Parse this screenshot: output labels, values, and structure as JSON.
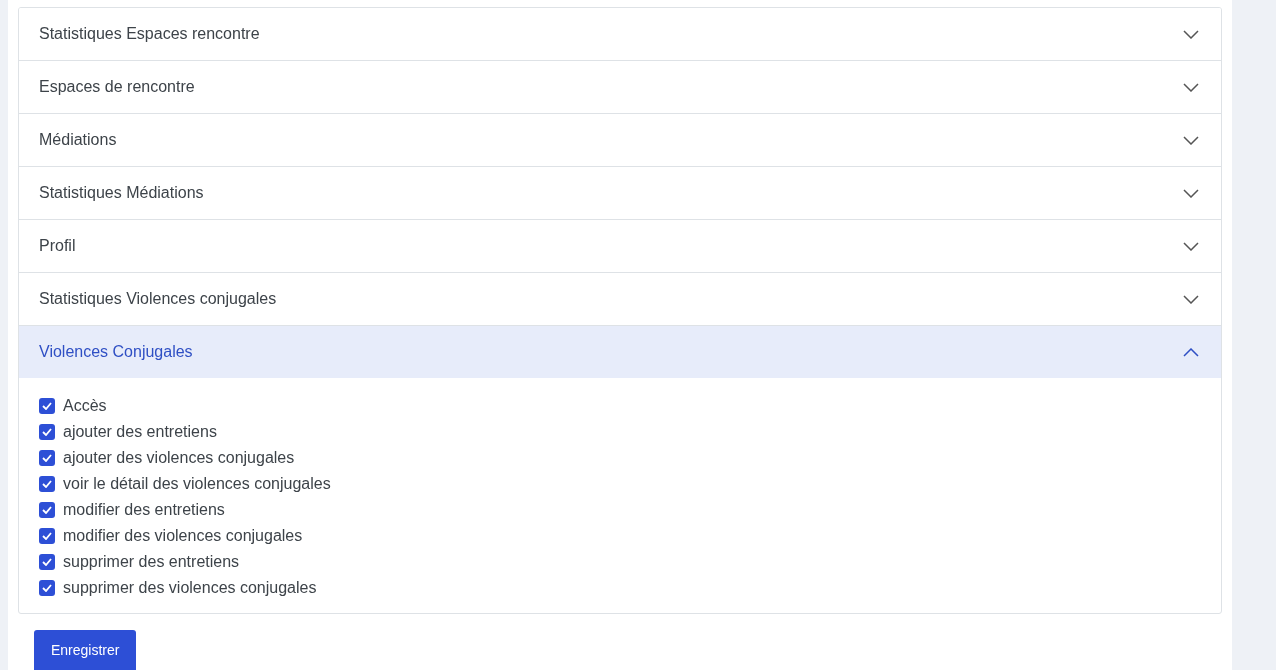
{
  "sections": [
    {
      "title": "Statistiques Espaces rencontre",
      "expanded": false
    },
    {
      "title": "Espaces de rencontre",
      "expanded": false
    },
    {
      "title": "Médiations",
      "expanded": false
    },
    {
      "title": "Statistiques Médiations",
      "expanded": false
    },
    {
      "title": "Profil",
      "expanded": false
    },
    {
      "title": "Statistiques Violences conjugales",
      "expanded": false
    },
    {
      "title": "Violences Conjugales",
      "expanded": true,
      "permissions": [
        {
          "label": "Accès",
          "checked": true
        },
        {
          "label": "ajouter des entretiens",
          "checked": true
        },
        {
          "label": "ajouter des violences conjugales",
          "checked": true
        },
        {
          "label": "voir le détail des violences conjugales",
          "checked": true
        },
        {
          "label": "modifier des entretiens",
          "checked": true
        },
        {
          "label": "modifier des violences conjugales",
          "checked": true
        },
        {
          "label": "supprimer des entretiens",
          "checked": true
        },
        {
          "label": "supprimer des violences conjugales",
          "checked": true
        }
      ]
    }
  ],
  "save_button": "Enregistrer"
}
